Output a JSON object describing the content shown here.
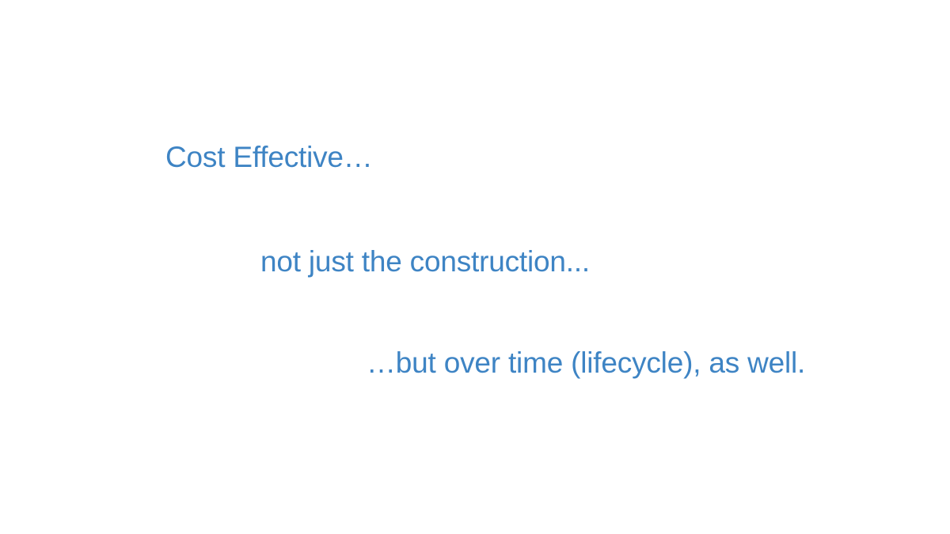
{
  "slide": {
    "text_color": "#3e84c4",
    "background_color": "#ffffff",
    "lines": [
      "Cost Effective…",
      "not just the construction...",
      "…but over time (lifecycle), as well."
    ]
  }
}
